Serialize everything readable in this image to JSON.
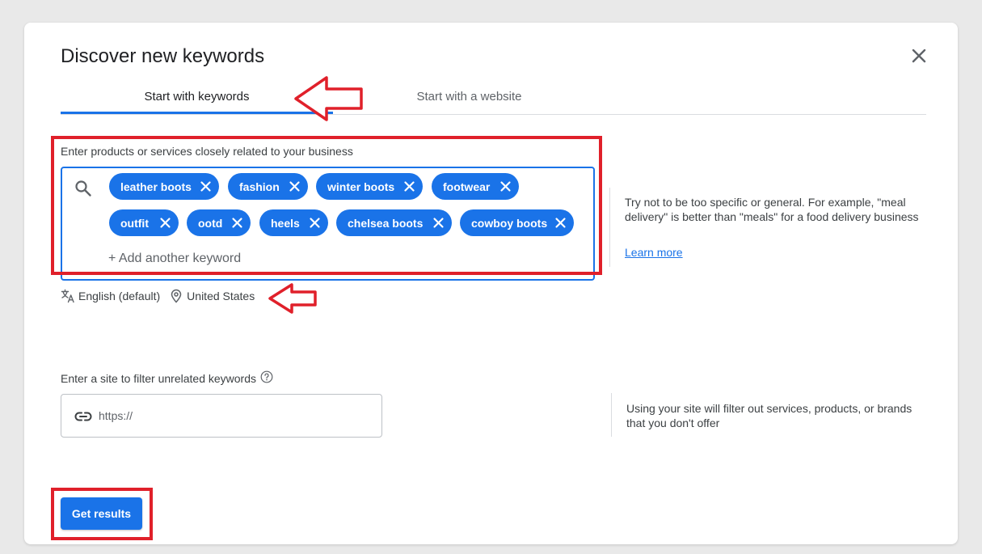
{
  "dialog": {
    "title": "Discover new keywords",
    "close_icon": "close-icon"
  },
  "tabs": [
    {
      "label": "Start with keywords",
      "active": true
    },
    {
      "label": "Start with a website",
      "active": false
    }
  ],
  "keywords": {
    "label": "Enter products or services closely related to your business",
    "chips": [
      "leather boots",
      "fashion",
      "winter boots",
      "footwear",
      "outfit",
      "ootd",
      "heels",
      "chelsea boots",
      "cowboy boots"
    ],
    "add_placeholder": "+ Add another keyword",
    "language": "English (default)",
    "location": "United States",
    "tip": "Try not to be too specific or general. For example, \"meal delivery\" is better than \"meals\" for a food delivery business",
    "learn_more": "Learn more"
  },
  "site_filter": {
    "label": "Enter a site to filter unrelated keywords",
    "placeholder": "https://",
    "tip": "Using your site will filter out services, products, or brands that you don't offer"
  },
  "actions": {
    "get_results": "Get results"
  },
  "colors": {
    "accent": "#1a73e8",
    "annotation": "#e0202a"
  }
}
